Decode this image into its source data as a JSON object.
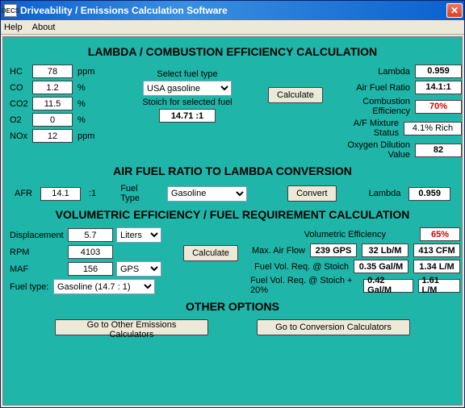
{
  "window": {
    "title": "Driveability / Emissions Calculation Software",
    "icon_text": "DECS"
  },
  "menu": {
    "help": "Help",
    "about": "About"
  },
  "sec1": {
    "heading": "LAMBDA / COMBUSTION EFFICIENCY CALCULATION",
    "hc_label": "HC",
    "hc_val": "78",
    "hc_unit": "ppm",
    "co_label": "CO",
    "co_val": "1.2",
    "co_unit": "%",
    "co2_label": "CO2",
    "co2_val": "11.5",
    "co2_unit": "%",
    "o2_label": "O2",
    "o2_val": "0",
    "o2_unit": "%",
    "nox_label": "NOx",
    "nox_val": "12",
    "nox_unit": "ppm",
    "fueltype_label": "Select fuel type",
    "fueltype_val": "USA gasoline",
    "stoich_label": "Stoich for selected fuel",
    "stoich_val": "14.71 :1",
    "calc_btn": "Calculate",
    "lambda_label": "Lambda",
    "lambda_val": "0.959",
    "afr_label": "Air Fuel Ratio",
    "afr_val": "14.1:1",
    "ce_label": "Combustion Efficiency",
    "ce_val": "70%",
    "mix_label": "A/F Mixture Status",
    "mix_val": "4.1% Rich",
    "od_label": "Oxygen Dilution Value",
    "od_val": "82"
  },
  "sec2": {
    "heading": "AIR FUEL RATIO TO LAMBDA CONVERSION",
    "afr_label": "AFR",
    "afr_val": "14.1",
    "afr_unit": ":1",
    "fueltype_label": "Fuel Type",
    "fueltype_val": "Gasoline",
    "convert_btn": "Convert",
    "lambda_label": "Lambda",
    "lambda_val": "0.959"
  },
  "sec3": {
    "heading": "VOLUMETRIC EFFICIENCY / FUEL REQUIREMENT CALCULATION",
    "disp_label": "Displacement",
    "disp_val": "5.7",
    "disp_unit": "Liters",
    "rpm_label": "RPM",
    "rpm_val": "4103",
    "maf_label": "MAF",
    "maf_val": "156",
    "maf_unit": "GPS",
    "fueltype_label": "Fuel type:",
    "fueltype_val": "Gasoline  (14.7 : 1)",
    "calc_btn": "Calculate",
    "ve_label": "Volumetric Efficiency",
    "ve_val": "65%",
    "maxaf_label": "Max. Air Flow",
    "maxaf_1": "239 GPS",
    "maxaf_2": "32 Lb/M",
    "maxaf_3": "413 CFM",
    "fvrs_label": "Fuel Vol. Req. @ Stoich",
    "fvrs_1": "0.35 Gal/M",
    "fvrs_2": "1.34 L/M",
    "fvrs20_label": "Fuel Vol. Req. @ Stoich + 20%",
    "fvrs20_1": "0.42 Gal/M",
    "fvrs20_2": "1.61 L/M"
  },
  "other": {
    "heading": "OTHER OPTIONS",
    "btn1": "Go to Other Emissions Calculators",
    "btn2": "Go to Conversion Calculators"
  }
}
